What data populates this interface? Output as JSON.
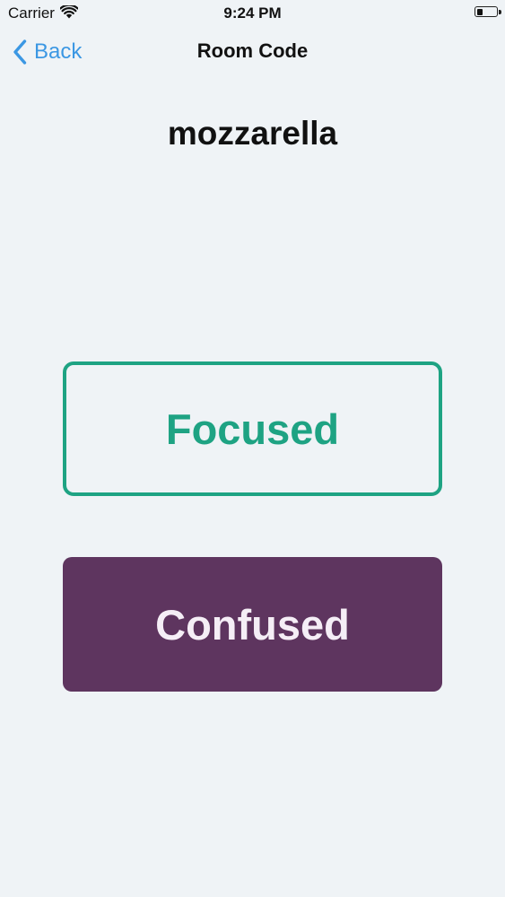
{
  "status_bar": {
    "carrier": "Carrier",
    "time": "9:24 PM",
    "battery_level": 0.4
  },
  "nav": {
    "back_label": "Back",
    "title": "Room Code"
  },
  "room": {
    "code": "mozzarella"
  },
  "actions": {
    "focused_label": "Focused",
    "confused_label": "Confused"
  },
  "colors": {
    "background": "#eff3f6",
    "accent_blue": "#3b97e3",
    "focused_green": "#1ea383",
    "confused_purple": "#5e355f"
  },
  "icons": {
    "wifi": "wifi-icon",
    "battery": "battery-icon",
    "back": "chevron-left-icon"
  }
}
